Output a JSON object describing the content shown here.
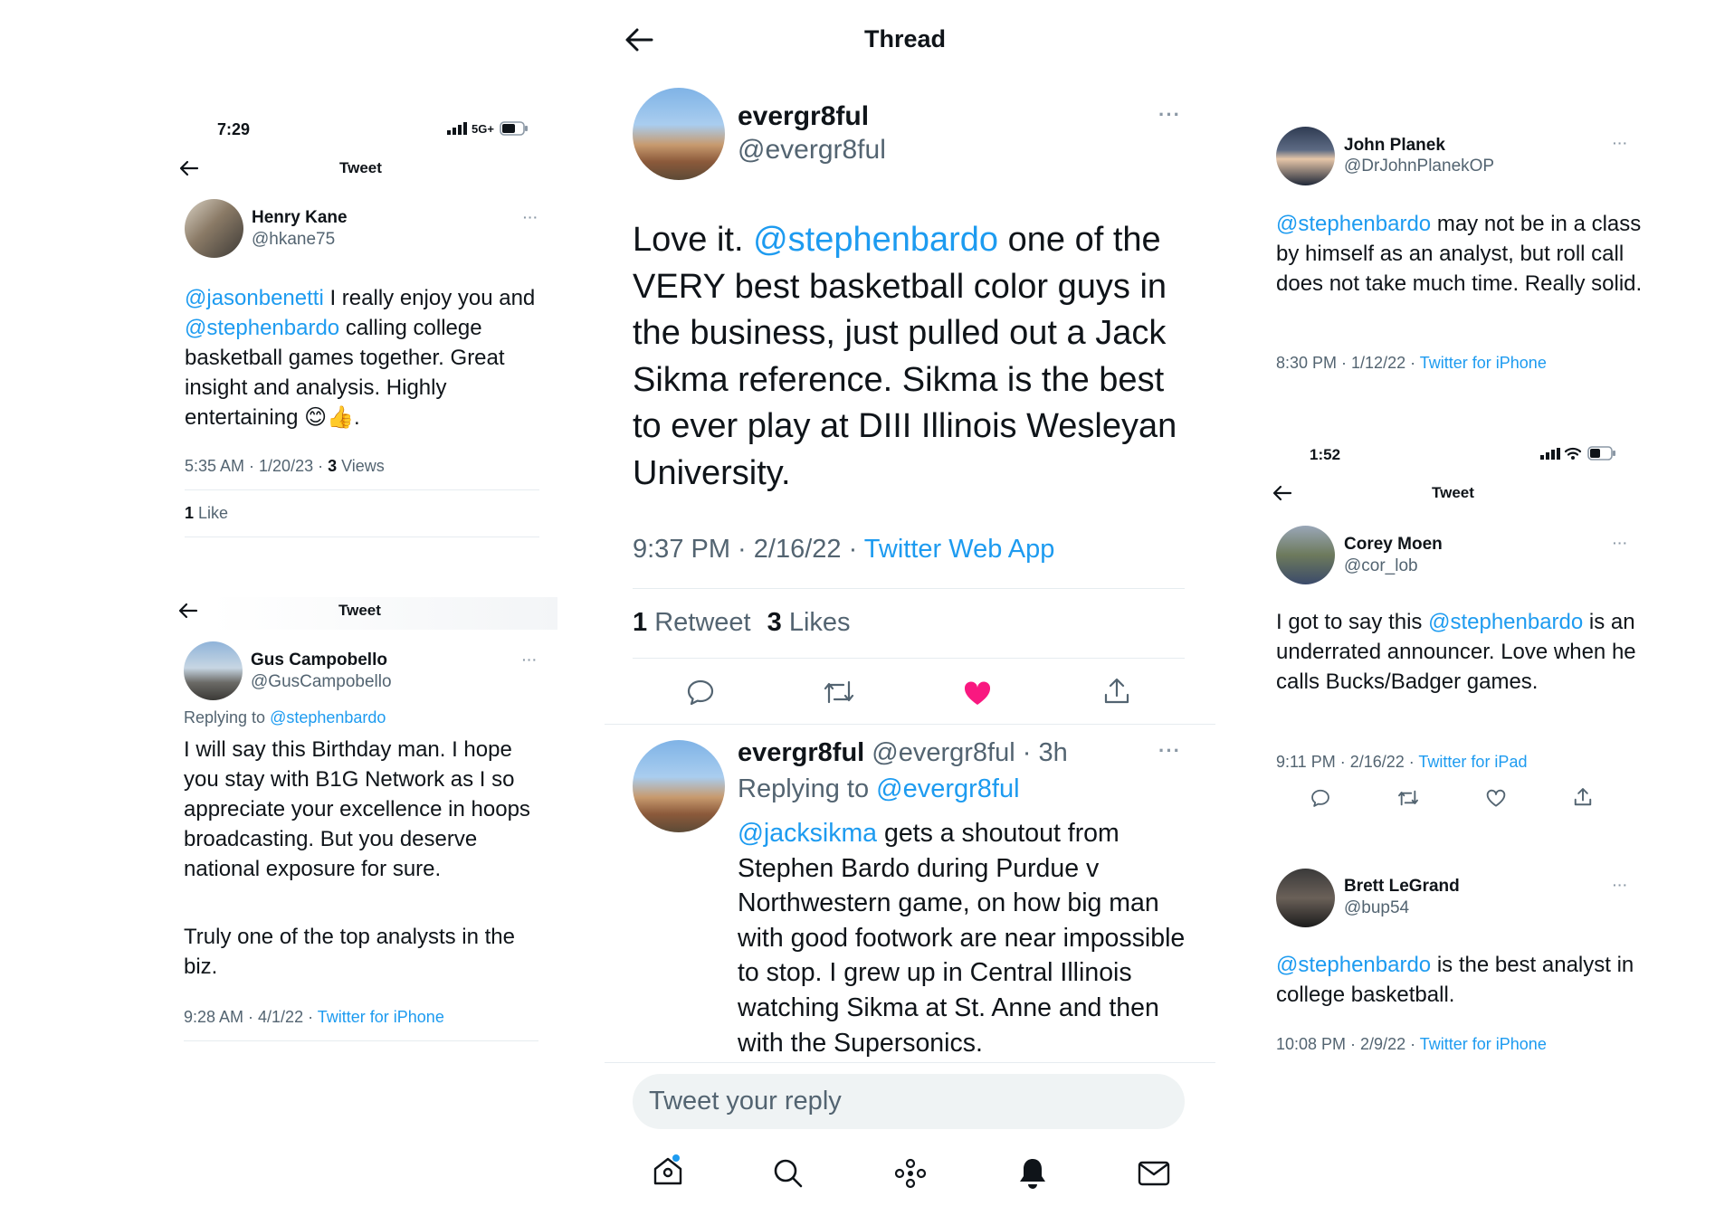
{
  "center": {
    "header_title": "Thread",
    "main_tweet": {
      "display_name": "evergr8ful",
      "handle": "@evergr8ful",
      "text_1": "Love it. ",
      "mention": "@stephenbardo",
      "text_2": " one of the VERY best basketball color guys in the business, just pulled out a Jack Sikma reference. Sikma is the best to ever play at DIII Illinois Wesleyan University.",
      "meta_time": "9:37 PM · 2/16/22 · ",
      "meta_source": "Twitter Web App",
      "retweet_count": "1",
      "retweet_label": " Retweet",
      "like_count": "3",
      "like_label": " Likes"
    },
    "reply_tweet": {
      "display_name": "evergr8ful",
      "handle_time": " @evergr8ful · 3h",
      "replying_label": "Replying to ",
      "replying_handle": "@evergr8ful",
      "mention": "@jacksikma",
      "text": " gets a shoutout from Stephen Bardo during Purdue v Northwestern game, on how big man with good footwork are near impossible to stop. I grew up in Central Illinois watching Sikma at St. Anne and then with the Supersonics."
    },
    "reply_placeholder": "Tweet your reply"
  },
  "left_top": {
    "status_time": "7:29",
    "status_network": "5G+",
    "header_title": "Tweet",
    "display_name": "Henry Kane",
    "handle": "@hkane75",
    "mention_1": "@jasonbenetti",
    "text_1": " I really enjoy you and ",
    "mention_2": "@stephenbardo",
    "text_2": " calling college basketball games together. Great insight and analysis. Highly entertaining 😊👍.",
    "meta_time": "5:35 AM · 1/20/23 · ",
    "views_count": "3",
    "views_label": " Views",
    "likes_count": "1",
    "likes_label": " Like"
  },
  "left_bottom": {
    "header_title": "Tweet",
    "display_name": "Gus Campobello",
    "handle": "@GusCampobello",
    "replying_label": "Replying to ",
    "replying_handle": "@stephenbardo",
    "text_1": "I will say this Birthday man.  I hope you stay with B1G Network as I so appreciate your excellence in hoops broadcasting.  But you deserve national exposure for sure.",
    "text_2": "Truly one of the top analysts in the biz.",
    "meta_time": "9:28 AM · 4/1/22 · ",
    "meta_source": "Twitter for iPhone"
  },
  "right_top": {
    "display_name": "John Planek",
    "handle": "@DrJohnPlanekOP",
    "mention": "@stephenbardo",
    "text": " may not be in a class by himself as an analyst, but roll call does not take much time. Really solid.",
    "meta_time": "8:30 PM · 1/12/22 · ",
    "meta_source": "Twitter for iPhone"
  },
  "right_middle": {
    "status_time": "1:52",
    "header_title": "Tweet",
    "display_name": "Corey Moen",
    "handle": "@cor_lob",
    "text_1": "I got to say this ",
    "mention": "@stephenbardo",
    "text_2": " is an underrated announcer. Love when he calls Bucks/Badger games.",
    "meta_time": "9:11 PM · 2/16/22 · ",
    "meta_source": "Twitter for iPad"
  },
  "right_bottom": {
    "display_name": "Brett LeGrand",
    "handle": "@bup54",
    "mention": "@stephenbardo",
    "text": " is the best analyst in college basketball.",
    "meta_time": "10:08 PM · 2/9/22 · ",
    "meta_source": "Twitter for iPhone"
  },
  "more_glyph": "···",
  "icons": [
    "back-arrow-icon",
    "more-icon",
    "reply-icon",
    "retweet-icon",
    "like-icon",
    "share-icon",
    "home-icon",
    "search-icon",
    "spaces-icon",
    "notifications-icon",
    "messages-icon",
    "signal-icon",
    "wifi-icon",
    "battery-icon"
  ],
  "colors": {
    "link": "#1d9bf0",
    "like": "#f91880",
    "muted": "#536471",
    "text": "#0f1419"
  }
}
